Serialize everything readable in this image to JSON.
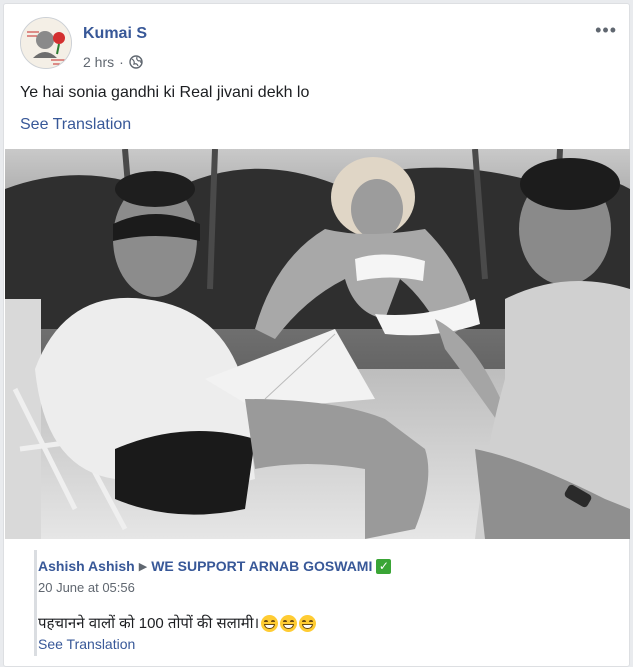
{
  "post": {
    "author": "Kumai S",
    "time": "2 hrs",
    "separator": "·",
    "more_label": "•••",
    "text": "Ye hai sonia gandhi ki Real jivani dekh lo",
    "see_translation": "See Translation",
    "privacy_icon": "globe-icon"
  },
  "shared": {
    "author": "Ashish Ashish",
    "arrow": "▶",
    "target": "WE SUPPORT ARNAB GOSWAMI",
    "check": "✓",
    "date": "20 June at 05:56",
    "text": "पहचानने वालों को 100 तोपों की सलामी।",
    "see_translation": "See Translation"
  },
  "colors": {
    "link": "#385898",
    "secondary": "#606770",
    "check_green": "#3aa536"
  }
}
